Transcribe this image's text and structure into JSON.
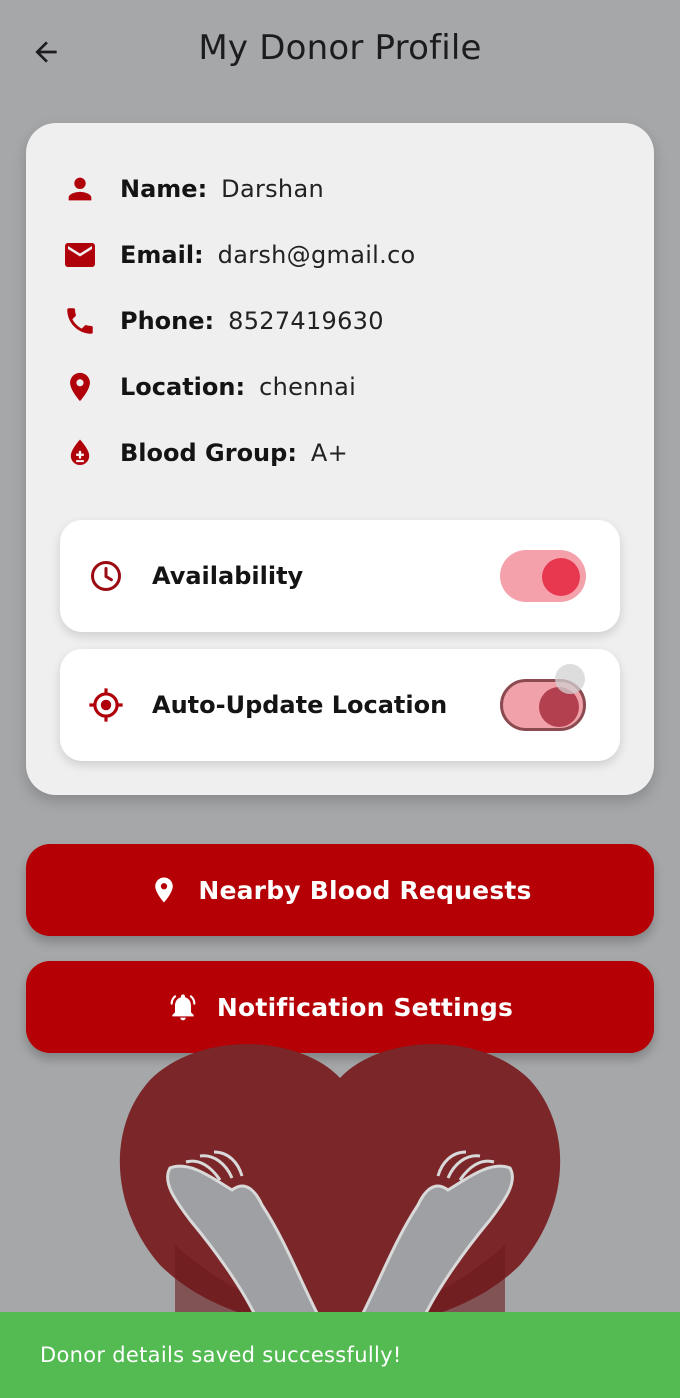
{
  "appbar": {
    "title": "My Donor Profile",
    "back_icon": "arrow-back-icon"
  },
  "profile": {
    "fields": [
      {
        "label": "Name:",
        "value": "Darshan",
        "icon": "person-icon"
      },
      {
        "label": "Email:",
        "value": "darsh@gmail.co",
        "icon": "mail-icon"
      },
      {
        "label": "Phone:",
        "value": "8527419630",
        "icon": "phone-icon"
      },
      {
        "label": "Location:",
        "value": "chennai",
        "icon": "location-pin-icon"
      },
      {
        "label": "Blood Group:",
        "value": "A+",
        "icon": "blood-drop-icon"
      }
    ]
  },
  "toggles": {
    "availability": {
      "label": "Availability",
      "on": true,
      "icon": "clock-icon"
    },
    "auto_location": {
      "label": "Auto-Update Location",
      "on": true,
      "icon": "gps-target-icon"
    }
  },
  "buttons": {
    "nearby": {
      "label": "Nearby Blood Requests",
      "icon": "location-pin-icon"
    },
    "notifications": {
      "label": "Notification Settings",
      "icon": "bell-icon"
    }
  },
  "snackbar": {
    "message": "Donor details saved successfully!"
  },
  "colors": {
    "primary": "#b50006",
    "icon_red": "#b0000a",
    "switch_track": "#f4a1ab",
    "switch_thumb": "#e8384f",
    "snackbar": "#53bb52",
    "overlay_bg": "#a6a7a9"
  }
}
